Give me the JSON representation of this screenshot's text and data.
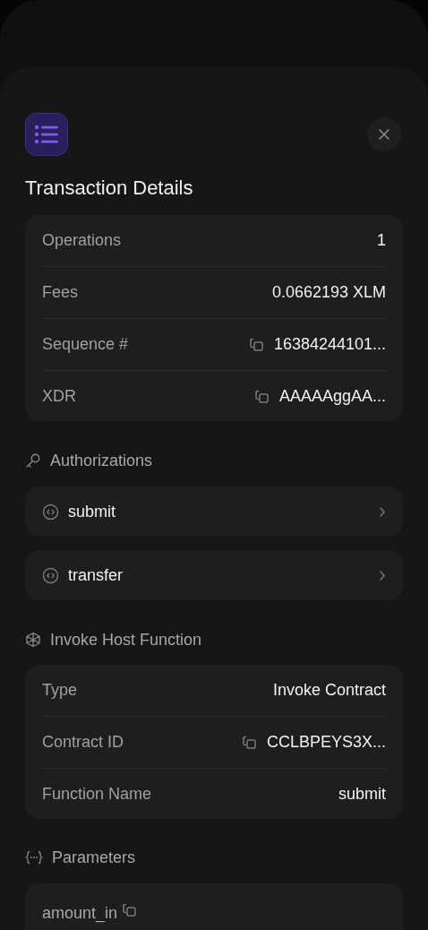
{
  "title": "Transaction Details",
  "details": [
    {
      "label": "Operations",
      "value": "1",
      "copyable": false
    },
    {
      "label": "Fees",
      "value": "0.0662193 XLM",
      "copyable": false
    },
    {
      "label": "Sequence #",
      "value": "16384244101...",
      "copyable": true
    },
    {
      "label": "XDR",
      "value": "AAAAAggAA...",
      "copyable": true
    }
  ],
  "sections": [
    {
      "kind": "authorizations",
      "title": "Authorizations",
      "items": [
        "submit",
        "transfer"
      ]
    },
    {
      "kind": "host_function",
      "title": "Invoke Host Function",
      "rows": [
        {
          "label": "Type",
          "value": "Invoke Contract",
          "copyable": false
        },
        {
          "label": "Contract ID",
          "value": "CCLBPEYS3X...",
          "copyable": true
        },
        {
          "label": "Function Name",
          "value": "submit",
          "copyable": false
        }
      ]
    },
    {
      "kind": "parameters",
      "title": "Parameters",
      "params": [
        {
          "name": "amount_in",
          "copyable": true
        }
      ]
    }
  ]
}
